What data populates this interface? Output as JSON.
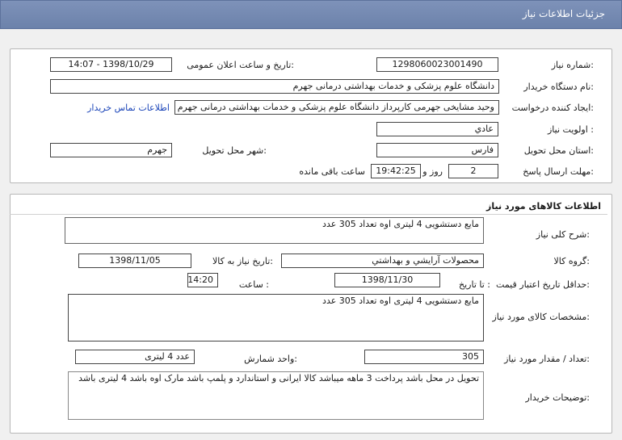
{
  "header": {
    "title": "جزئیات اطلاعات نیاز"
  },
  "details": {
    "need_number_label": "شماره نیاز:",
    "need_number": "1298060023001490",
    "announce_label": "تاریخ و ساعت اعلان عمومی:",
    "announce_value": "1398/10/29 - 14:07",
    "buyer_label": "نام دستگاه خریدار:",
    "buyer_value": "دانشگاه علوم پزشکی و خدمات بهداشتی درمانی جهرم",
    "creator_label": "ایجاد کننده درخواست:",
    "creator_value": "وحید مشایخی جهرمی کارپرداز دانشگاه علوم پزشکی و خدمات بهداشتی درمانی جهرم",
    "contact_link": "اطلاعات تماس خریدار",
    "priority_label": "اولویت نیاز :",
    "priority_value": "عادي",
    "province_label": "استان محل تحویل:",
    "province_value": "فارس",
    "city_label": "شهر محل تحویل:",
    "city_value": "جهرم",
    "deadline_label": "مهلت ارسال پاسخ:",
    "deadline_days": "2",
    "days_and": "روز و",
    "deadline_time": "19:42:25",
    "remaining": "ساعت باقی مانده"
  },
  "goods": {
    "section_title": "اطلاعات کالاهای مورد نیاز",
    "summary_label": "شرح کلی نیاز:",
    "summary_value": "مایع دستشویی 4 لیتری اوه تعداد 305 عدد",
    "group_label": "گروه کالا:",
    "group_value": "محصولات آرایشي و بهداشتي",
    "need_date_label": "تاریخ نیاز به کالا:",
    "need_date_value": "1398/11/05",
    "validity_label": "حداقل تاریخ اعتبار قیمت:",
    "to_date_label": "تا تاریخ :",
    "to_date_value": "1398/11/30",
    "time_label": "ساعت :",
    "time_value": "14:20",
    "specs_label": "مشخصات کالای مورد نیاز:",
    "specs_value": "مایع دستشویی 4 لیتری اوه  تعداد 305 عدد",
    "qty_label": "تعداد / مقدار مورد نیاز:",
    "qty_value": "305",
    "unit_label": "واحد شمارش:",
    "unit_value": "عدد 4 لیتری",
    "notes_label": "توضیحات خریدار:",
    "notes_value": "تحویل در محل باشد پرداخت 3 ماهه میباشد کالا ایرانی و استاندارد و پلمپ باشد مارک اوه باشد 4 لیتری باشد"
  }
}
